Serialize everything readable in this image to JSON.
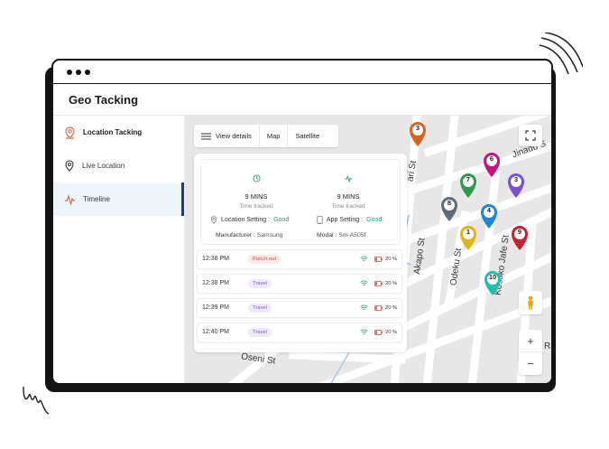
{
  "app": {
    "title": "Geo Tacking"
  },
  "sidebar": {
    "items": [
      {
        "label": "Location Tacking"
      },
      {
        "label": "Live Location"
      },
      {
        "label": "Timeline"
      }
    ]
  },
  "map": {
    "tabs": [
      {
        "label": "View details"
      },
      {
        "label": "Map"
      },
      {
        "label": "Satellite"
      }
    ],
    "streets": [
      "ari St",
      "Jinadu S",
      "Akapo St",
      "Odeku St",
      "Kosoko Jafe St",
      "Oseni St",
      "Ra"
    ],
    "pins": [
      {
        "number": "3",
        "color": "#d4651f"
      },
      {
        "number": "6",
        "color": "#c4137a"
      },
      {
        "number": "7",
        "color": "#2e9b4a"
      },
      {
        "number": "3",
        "color": "#7a4fd6"
      },
      {
        "number": "8",
        "color": "#5f6b78"
      },
      {
        "number": "4",
        "color": "#1c88d6"
      },
      {
        "number": "1",
        "color": "#e3b416"
      },
      {
        "number": "9",
        "color": "#c8202f"
      },
      {
        "number": "10",
        "color": "#1fbfae"
      }
    ],
    "zoom_in": "+",
    "zoom_out": "−"
  },
  "summary": {
    "left": {
      "value": "9 MINS",
      "label": "Time tracked"
    },
    "right": {
      "value": "9 MINS",
      "label": "Time tracked"
    },
    "location_setting": {
      "label": "Location Setting :",
      "value": "Good"
    },
    "app_setting": {
      "label": "App Setting :",
      "value": "Good"
    },
    "manufacturer": {
      "label": "Manufacturer :",
      "value": "Samsung"
    },
    "modal": {
      "label": "Modal :",
      "value": "Sm-A505f"
    }
  },
  "timeline": [
    {
      "time": "12:38 PM",
      "status": "Punch out",
      "battery": "20 %"
    },
    {
      "time": "12:38 PM",
      "status": "Travel",
      "battery": "20 %"
    },
    {
      "time": "12:39 PM",
      "status": "Travel",
      "battery": "20 %"
    },
    {
      "time": "12:40 PM",
      "status": "Travel",
      "battery": "20 %"
    }
  ],
  "colors": {
    "accent": "#1a3a8a",
    "good": "#22a06b",
    "punch_out": "#d64535",
    "travel": "#7b55d0",
    "location_icon": "#e0694f"
  }
}
